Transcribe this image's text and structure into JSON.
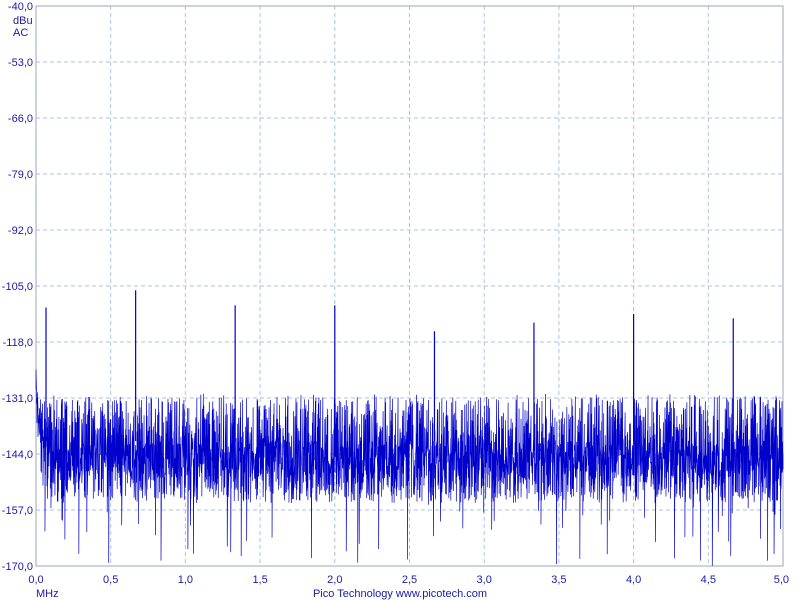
{
  "chart_data": {
    "type": "line",
    "title": "",
    "xlabel": "MHz",
    "ylabel_lines": [
      "dBu",
      "AC"
    ],
    "xlim": [
      0.0,
      5.0
    ],
    "ylim": [
      -170.0,
      -40.0
    ],
    "x_ticks": [
      {
        "value": 0.0,
        "label": "0,0"
      },
      {
        "value": 0.5,
        "label": "0,5"
      },
      {
        "value": 1.0,
        "label": "1,0"
      },
      {
        "value": 1.5,
        "label": "1,5"
      },
      {
        "value": 2.0,
        "label": "2,0"
      },
      {
        "value": 2.5,
        "label": "2,5"
      },
      {
        "value": 3.0,
        "label": "3,0"
      },
      {
        "value": 3.5,
        "label": "3,5"
      },
      {
        "value": 4.0,
        "label": "4,0"
      },
      {
        "value": 4.5,
        "label": "4,5"
      },
      {
        "value": 5.0,
        "label": "5,0"
      }
    ],
    "y_ticks": [
      {
        "value": -40.0,
        "label": "-40,0"
      },
      {
        "value": -53.0,
        "label": "-53,0"
      },
      {
        "value": -66.0,
        "label": "-66,0"
      },
      {
        "value": -79.0,
        "label": "-79,0"
      },
      {
        "value": -92.0,
        "label": "-92,0"
      },
      {
        "value": -105.0,
        "label": "-105,0"
      },
      {
        "value": -118.0,
        "label": "-118,0"
      },
      {
        "value": -131.0,
        "label": "-131,0"
      },
      {
        "value": -144.0,
        "label": "-144,0"
      },
      {
        "value": -157.0,
        "label": "-157,0"
      },
      {
        "value": -170.0,
        "label": "-170,0"
      }
    ],
    "grid": true,
    "series": [
      {
        "color": "#0000cc",
        "noise_floor": {
          "baseline_db": -141.0,
          "upper_envelope_db": -132.0,
          "lower_envelope_db": -152.0,
          "min_dip_db": -170.0,
          "low_freq_rise_db": -120.0
        },
        "peaks": [
          {
            "x": 0.067,
            "y": -110.0
          },
          {
            "x": 0.667,
            "y": -106.0
          },
          {
            "x": 1.333,
            "y": -109.5
          },
          {
            "x": 2.0,
            "y": -109.5
          },
          {
            "x": 2.667,
            "y": -115.5
          },
          {
            "x": 3.333,
            "y": -113.5
          },
          {
            "x": 4.0,
            "y": -111.5
          },
          {
            "x": 4.667,
            "y": -112.5
          }
        ]
      }
    ]
  },
  "footer": {
    "text": "Pico Technology  www.picotech.com"
  },
  "colors": {
    "trace": "#0000cc",
    "axis_text": "#1a1aa6",
    "grid": "#a9c6dc",
    "frame": "#9aa7b6"
  }
}
